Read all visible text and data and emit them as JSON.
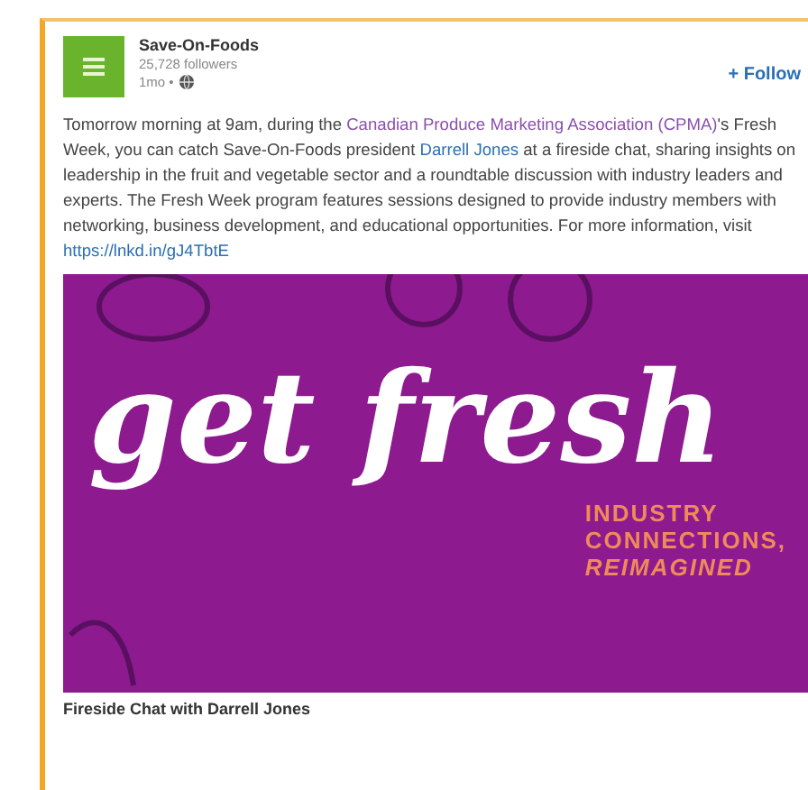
{
  "post": {
    "company": "Save-On-Foods",
    "followers": "25,728 followers",
    "time": "1mo •",
    "follow_button": "+ Follow",
    "body": [
      {
        "kind": "text",
        "text": "Tomorrow morning at 9am, during the "
      },
      {
        "kind": "link",
        "text": "Canadian Produce Marketing"
      },
      {
        "kind": "link",
        "text": "Association (CPMA)"
      },
      {
        "kind": "text",
        "text": "'s Fresh Week, you can catch Save-On-Foods president "
      },
      {
        "kind": "link",
        "text": "Darrell Jones"
      },
      {
        "kind": "text",
        "text": " at a fireside chat, sharing insights on leadership in the fruit and vegetable sector and a roundtable discussion with industry leaders and experts. The Fresh Week program features sessions designed to provide industry members with networking, business development, and educational opportunities. For more information, visit "
      },
      {
        "kind": "link",
        "text": "https://lnkd.in/gJ4TbtE"
      }
    ],
    "banner": {
      "headline": "get fresh",
      "tagline": [
        "INDUSTRY",
        "CONNECTIONS,",
        "REIMAGINED"
      ]
    },
    "caption": "Fireside Chat with Darrell Jones"
  }
}
